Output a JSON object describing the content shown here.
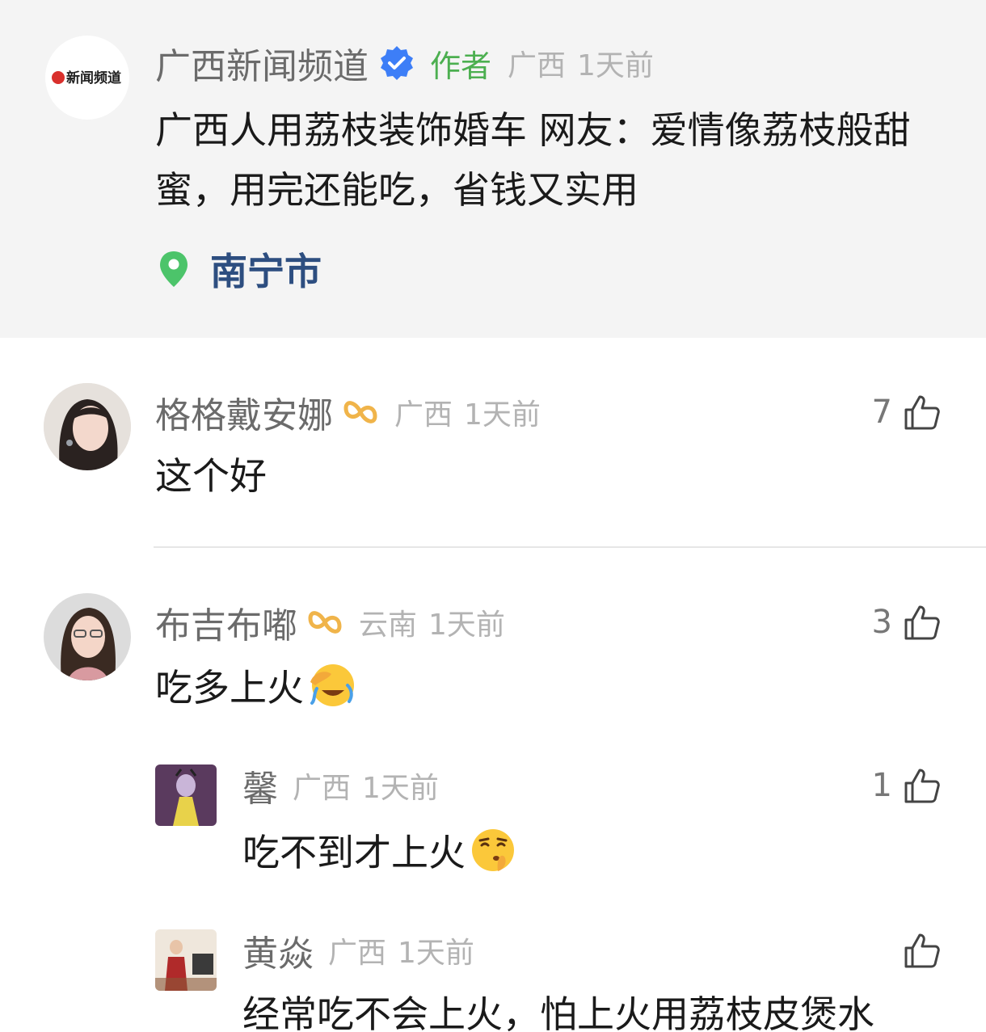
{
  "post": {
    "author": "广西新闻频道",
    "logo_text": "新闻频道",
    "author_tag": "作者",
    "region": "广西",
    "time": "1天前",
    "text": "广西人用荔枝装饰婚车 网友：爱情像荔枝般甜蜜，用完还能吃，省钱又实用",
    "location": "南宁市"
  },
  "comments": [
    {
      "name": "格格戴安娜",
      "region": "广西",
      "time": "1天前",
      "text": "这个好",
      "likes": "7"
    },
    {
      "name": "布吉布嘟",
      "region": "云南",
      "time": "1天前",
      "text": "吃多上火",
      "likes": "3"
    }
  ],
  "replies": [
    {
      "name": "馨",
      "region": "广西",
      "time": "1天前",
      "text": "吃不到才上火",
      "likes": "1"
    },
    {
      "name": "黄焱",
      "region": "广西",
      "time": "1天前",
      "text": "经常吃不会上火，怕上火用荔枝皮煲水",
      "likes": ""
    }
  ],
  "colors": {
    "verified": "#3d7ef7",
    "author_tag": "#4caf50",
    "location": "#2d4e80",
    "pin": "#4cc46a",
    "badge": "#f0b44a"
  }
}
